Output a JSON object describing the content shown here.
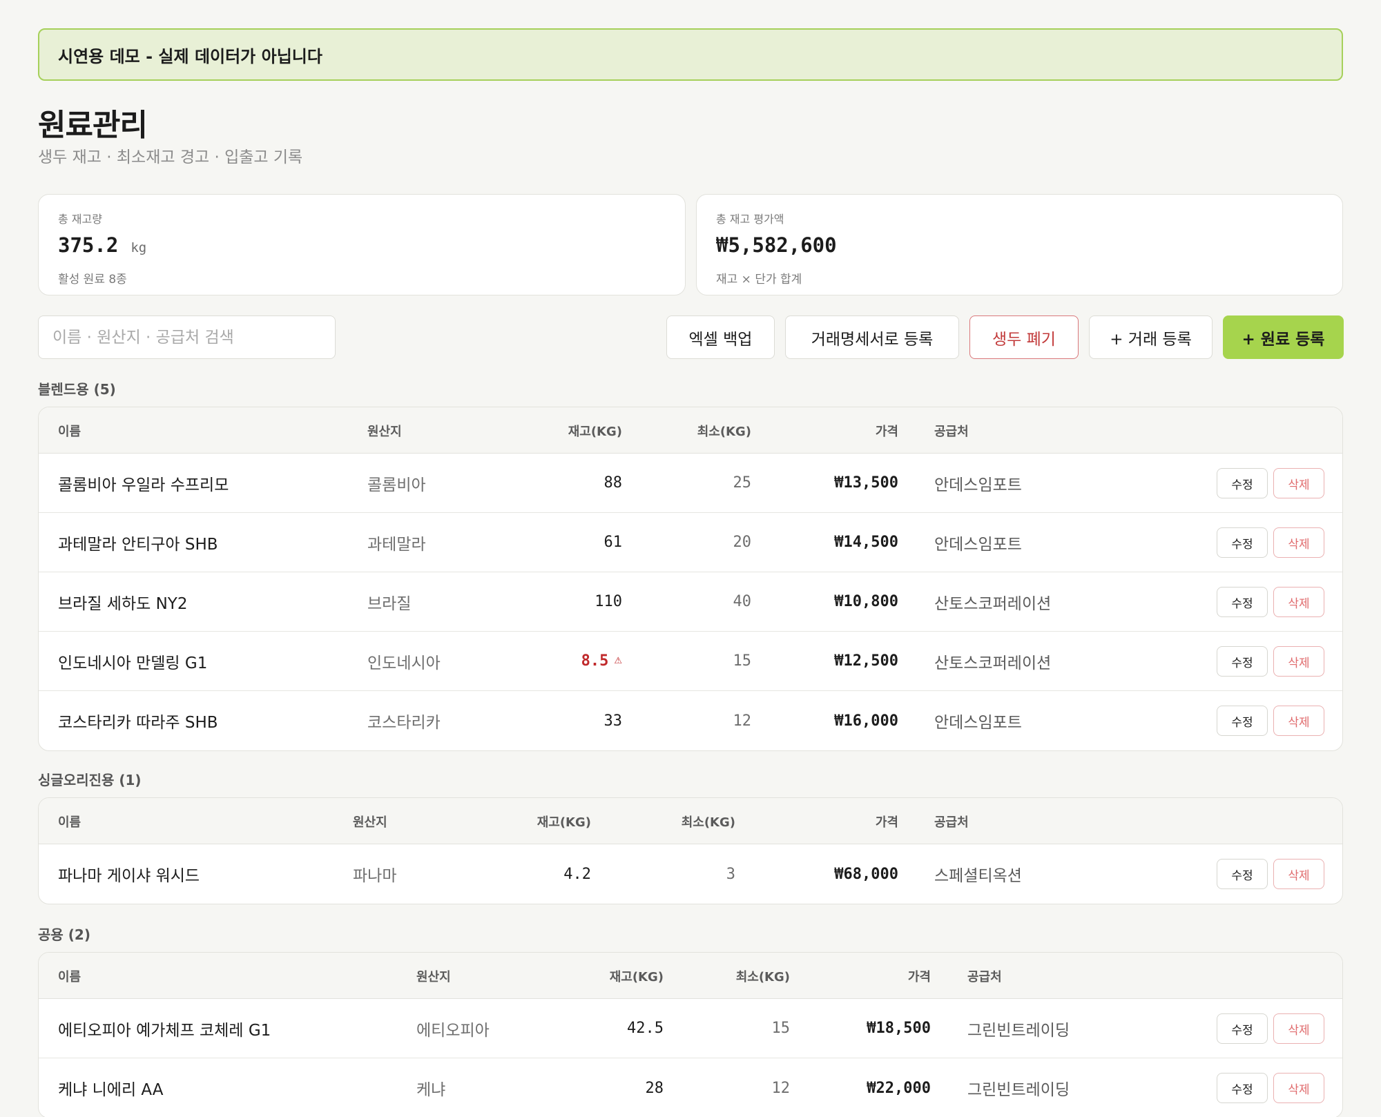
{
  "banner": "시연용 데모 - 실제 데이터가 아닙니다",
  "page": {
    "title": "원료관리",
    "subtitle": "생두 재고 · 최소재고 경고 · 입출고 기록"
  },
  "kpis": [
    {
      "label": "총 재고량",
      "value": "375.2",
      "unit": "kg",
      "note": "활성 원료 8종"
    },
    {
      "label": "총 재고 평가액",
      "value": "₩5,582,600",
      "note": "재고 × 단가 합계"
    }
  ],
  "search": {
    "placeholder": "이름 · 원산지 · 공급처 검색"
  },
  "toolbar": {
    "backup": "엑셀 백업",
    "invoice": "거래명세서로 등록",
    "discard": "생두 폐기",
    "trade": "+ 거래 등록",
    "add": "+ 원료 등록"
  },
  "columns": {
    "name": "이름",
    "origin": "원산지",
    "stock": "재고(KG)",
    "min": "최소(KG)",
    "price": "가격",
    "supplier": "공급처"
  },
  "actions": {
    "edit": "수정",
    "delete": "삭제"
  },
  "icons": {
    "low_stock": "warning-triangle-icon"
  },
  "colors": {
    "accent": "#a6d44d",
    "danger": "#c0292b",
    "banner_bg": "#e8f0d6"
  },
  "groups": [
    {
      "label": "블렌드용 (5)",
      "rows": [
        {
          "name": "콜롬비아 우일라 수프리모",
          "origin": "콜롬비아",
          "stock": "88",
          "min": "25",
          "price": "₩13,500",
          "supplier": "안데스임포트",
          "low": false
        },
        {
          "name": "과테말라 안티구아 SHB",
          "origin": "과테말라",
          "stock": "61",
          "min": "20",
          "price": "₩14,500",
          "supplier": "안데스임포트",
          "low": false
        },
        {
          "name": "브라질 세하도 NY2",
          "origin": "브라질",
          "stock": "110",
          "min": "40",
          "price": "₩10,800",
          "supplier": "산토스코퍼레이션",
          "low": false
        },
        {
          "name": "인도네시아 만델링 G1",
          "origin": "인도네시아",
          "stock": "8.5",
          "min": "15",
          "price": "₩12,500",
          "supplier": "산토스코퍼레이션",
          "low": true
        },
        {
          "name": "코스타리카 따라주 SHB",
          "origin": "코스타리카",
          "stock": "33",
          "min": "12",
          "price": "₩16,000",
          "supplier": "안데스임포트",
          "low": false
        }
      ]
    },
    {
      "label": "싱글오리진용 (1)",
      "rows": [
        {
          "name": "파나마 게이샤 워시드",
          "origin": "파나마",
          "stock": "4.2",
          "min": "3",
          "price": "₩68,000",
          "supplier": "스페셜티옥션",
          "low": false
        }
      ]
    },
    {
      "label": "공용 (2)",
      "rows": [
        {
          "name": "에티오피아 예가체프 코체레 G1",
          "origin": "에티오피아",
          "stock": "42.5",
          "min": "15",
          "price": "₩18,500",
          "supplier": "그린빈트레이딩",
          "low": false
        },
        {
          "name": "케냐 니에리 AA",
          "origin": "케냐",
          "stock": "28",
          "min": "12",
          "price": "₩22,000",
          "supplier": "그린빈트레이딩",
          "low": false
        }
      ]
    }
  ]
}
